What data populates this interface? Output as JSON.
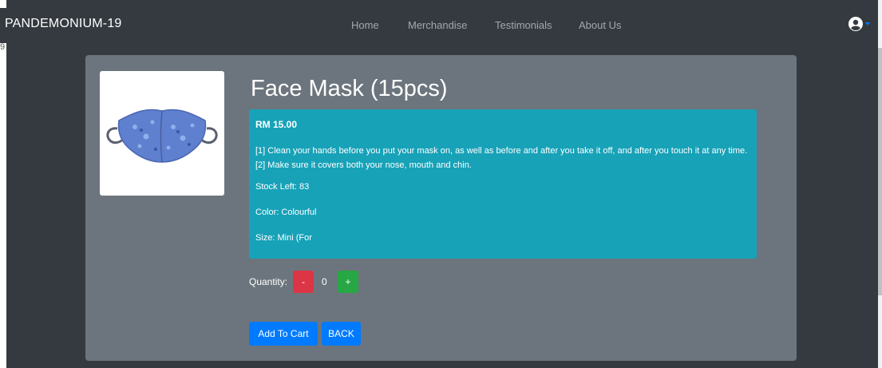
{
  "navbar": {
    "brand": "PANDEMONIUM-19",
    "links": [
      "Home",
      "Merchandise",
      "Testimonials",
      "About Us"
    ],
    "user_icon": "user-circle-icon"
  },
  "stray_text": "9",
  "product": {
    "title": "Face Mask (15pcs)",
    "price": "RM 15.00",
    "description": "[1] Clean your hands before you put your mask on, as well as before and after you take it off, and after you touch it at any time. [2] Make sure it covers both your nose, mouth and chin.",
    "stock": "Stock Left: 83",
    "color": "Color: Colourful",
    "size": "Size: Mini (For"
  },
  "quantity": {
    "label": "Quantity:",
    "minus": "-",
    "value": "0",
    "plus": "+"
  },
  "actions": {
    "add_to_cart": "Add To Cart",
    "back": "BACK"
  },
  "colors": {
    "navbar_bg": "#343a40",
    "card_bg": "#6c757d",
    "info_bg": "#17a2b8",
    "primary": "#007bff",
    "danger": "#dc3545",
    "success": "#28a745"
  }
}
